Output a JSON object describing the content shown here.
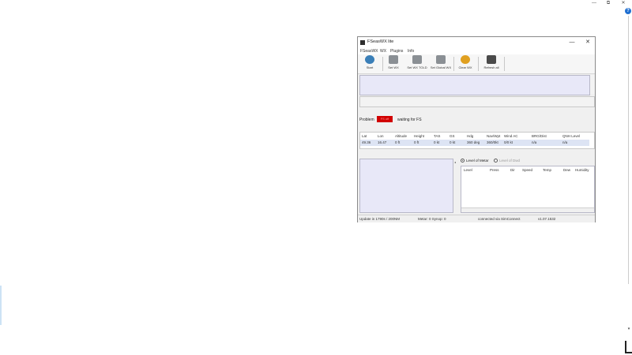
{
  "host": {
    "controls": {
      "minimize": "—",
      "restore": "⧉",
      "close": "✕"
    },
    "help": "?"
  },
  "window": {
    "title": "FSeasWX lite",
    "controls": {
      "minimize": "—",
      "maximize": "☐",
      "close": "✕"
    },
    "menu": [
      "FSeasWX",
      "WX",
      "Plugins",
      "Info"
    ],
    "toolbar": [
      {
        "label": "Start",
        "icon": "globe-icon",
        "color": "#3a7fb8"
      },
      {
        "label": "Set WX",
        "icon": "weather-set-icon",
        "color": "#8a8f94"
      },
      {
        "label": "Set WX TOLD",
        "icon": "weather-told-icon",
        "color": "#8a8f94"
      },
      {
        "label": "Set Global WX",
        "icon": "weather-global-icon",
        "color": "#8a8f94"
      },
      {
        "label": "Clear WX",
        "icon": "clear-weather-icon",
        "color": "#e0a020"
      },
      {
        "label": "Refresh all",
        "icon": "airplane-icon",
        "color": "#4a4a4a"
      }
    ],
    "status": {
      "label": "Problem",
      "badge": "FS off",
      "text": "waiting for FS",
      "badge_color": "#d10000"
    },
    "grid": {
      "headers": [
        "Lat",
        "Lon",
        "Altitude",
        "Height",
        "TAS",
        "GS",
        "Hdg",
        "Nav/Wpt",
        "Wind AC",
        "BRG/Dist",
        "QNH Level"
      ],
      "row": [
        "49.36",
        "16.47",
        "0 ft",
        "0 ft",
        "0 kt",
        "0 kt",
        "360 deg",
        "360/0kt",
        "0/0 kt",
        "n/a",
        "n/a"
      ]
    },
    "radios": {
      "selected": "Level of Metar",
      "other": "Level of Dwd"
    },
    "level_table_headers": [
      "Level",
      "Press",
      "Dir",
      "Speed",
      "Temp",
      "Dew",
      "Humidity"
    ],
    "statusbar": {
      "update": "Update in 1790s / 200NM",
      "metar": "Metar: 0 Synop: 0",
      "connection": "connected via SimConnect",
      "version": "v1.07.1532"
    }
  }
}
